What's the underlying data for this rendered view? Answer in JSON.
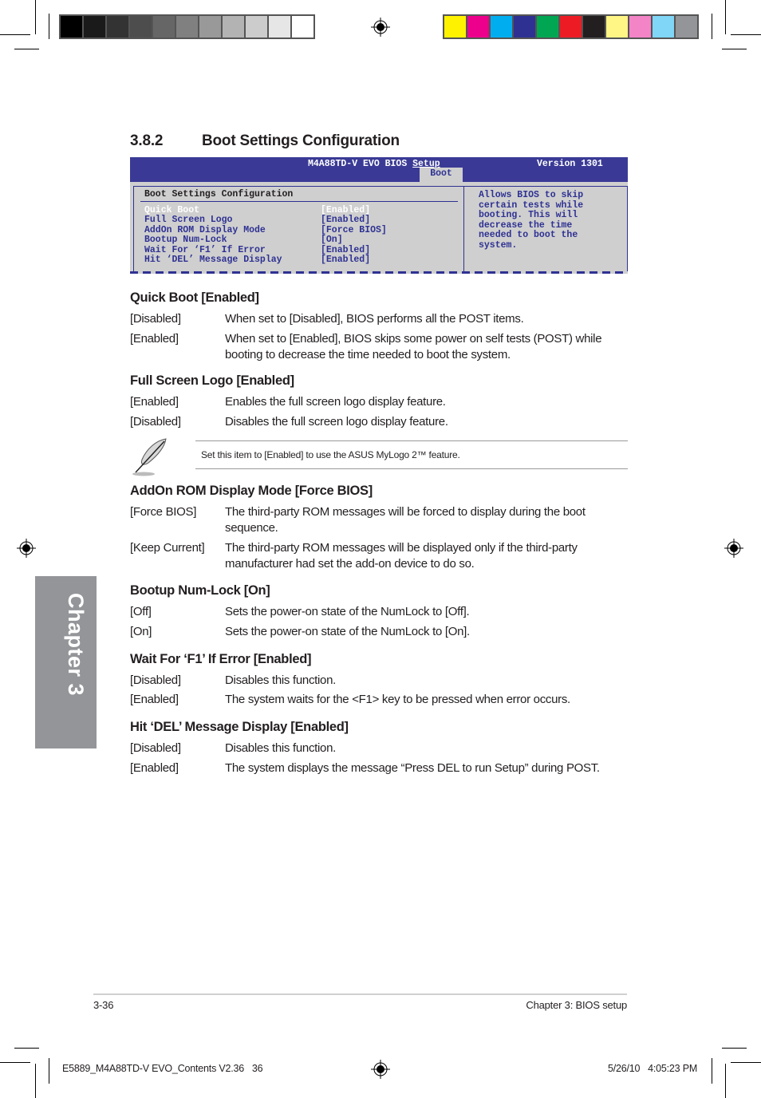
{
  "print_marks": {
    "grayscale_swatches": [
      "#000000",
      "#1a1a1a",
      "#333333",
      "#4d4d4d",
      "#666666",
      "#808080",
      "#999999",
      "#b3b3b3",
      "#cccccc",
      "#e6e6e6",
      "#ffffff"
    ],
    "color_swatches": [
      "#fff200",
      "#ec008c",
      "#00aeef",
      "#2e3192",
      "#00a651",
      "#ed1c24",
      "#231f20",
      "#fff685",
      "#f384c6",
      "#7fd6f7",
      "#939598"
    ]
  },
  "section": {
    "number": "3.8.2",
    "title": "Boot Settings Configuration"
  },
  "bios": {
    "title_prefix": "M4A88TD-V EVO BIOS ",
    "title_suffix": "Setup",
    "version": "Version 1301",
    "active_tab": "Boot",
    "panel_title": "Boot Settings Configuration",
    "items": [
      {
        "label": "Quick Boot",
        "value": "[Enabled]",
        "selected": true
      },
      {
        "label": "Full Screen Logo",
        "value": "[Enabled]",
        "selected": false
      },
      {
        "label": "AddOn ROM Display Mode",
        "value": "[Force BIOS]",
        "selected": false
      },
      {
        "label": "Bootup Num-Lock",
        "value": "[On]",
        "selected": false
      },
      {
        "label": "Wait For ‘F1’ If Error",
        "value": "[Enabled]",
        "selected": false
      },
      {
        "label": "Hit ‘DEL’ Message Display",
        "value": "[Enabled]",
        "selected": false
      }
    ],
    "help_text": "Allows BIOS to skip\ncertain tests while\nbooting. This will\ndecrease the time\nneeded to boot the\nsystem.",
    "colors": {
      "header_bg": "#3a3a96",
      "panel_bg": "#cfcfcf",
      "text": "#2e3192",
      "selected_text": "#ffffff"
    }
  },
  "settings": [
    {
      "heading": "Quick Boot [Enabled]",
      "options": [
        {
          "key": "[Disabled]",
          "desc": "When set to [Disabled], BIOS performs all the POST items."
        },
        {
          "key": "[Enabled]",
          "desc": "When set to [Enabled], BIOS skips some power on self tests (POST) while booting to decrease the time needed to boot the system."
        }
      ]
    },
    {
      "heading": "Full Screen Logo [Enabled]",
      "options": [
        {
          "key": "[Enabled]",
          "desc": "Enables the full screen logo display feature."
        },
        {
          "key": "[Disabled]",
          "desc": "Disables the full screen logo display feature."
        }
      ],
      "note": "Set this item to [Enabled] to use the ASUS MyLogo 2™ feature."
    },
    {
      "heading": "AddOn ROM Display Mode [Force BIOS]",
      "options": [
        {
          "key": "[Force BIOS]",
          "desc": "The third-party ROM messages will be forced to display during the boot sequence."
        },
        {
          "key": "[Keep Current]",
          "desc": "The third-party ROM messages will be displayed only if the third-party manufacturer had set the add-on device to do so."
        }
      ]
    },
    {
      "heading": "Bootup Num-Lock [On]",
      "options": [
        {
          "key": "[Off]",
          "desc": "Sets the power-on state of the NumLock to [Off]."
        },
        {
          "key": "[On]",
          "desc": "Sets the power-on state of the NumLock to [On]."
        }
      ]
    },
    {
      "heading": "Wait For ‘F1’ If Error [Enabled]",
      "options": [
        {
          "key": "[Disabled]",
          "desc": "Disables this function."
        },
        {
          "key": "[Enabled]",
          "desc": "The system waits for the <F1> key to be pressed when error occurs."
        }
      ]
    },
    {
      "heading": "Hit ‘DEL’ Message Display [Enabled]",
      "options": [
        {
          "key": "[Disabled]",
          "desc": "Disables this function."
        },
        {
          "key": "[Enabled]",
          "desc": "The system displays the message “Press DEL to run Setup” during POST."
        }
      ]
    }
  ],
  "chapter_tab": "Chapter 3",
  "footer": {
    "page_number": "3-36",
    "chapter_label": "Chapter 3: BIOS setup"
  },
  "slug": {
    "file_info": "E5889_M4A88TD-V EVO_Contents V2.36   36",
    "timestamp": "5/26/10   4:05:23 PM"
  }
}
